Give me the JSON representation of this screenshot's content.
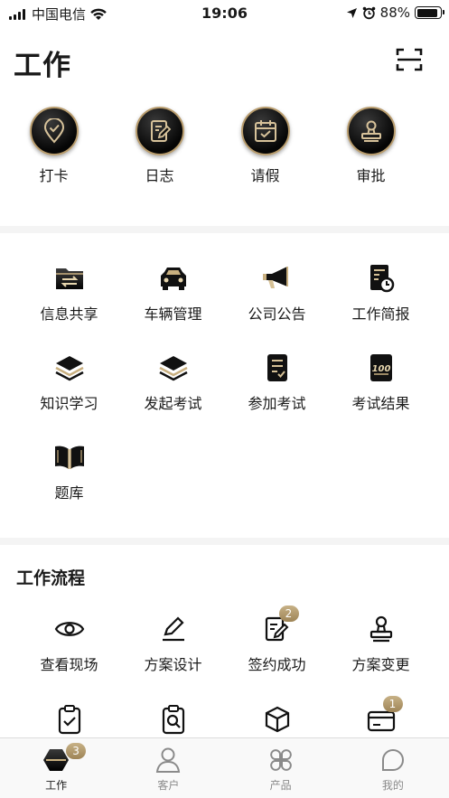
{
  "status_bar": {
    "carrier": "中国电信",
    "time": "19:06",
    "battery": "88%",
    "battery_level": 0.88
  },
  "header": {
    "title": "工作"
  },
  "quick_actions": [
    {
      "label": "打卡",
      "icon": "location-check-icon"
    },
    {
      "label": "日志",
      "icon": "journal-edit-icon"
    },
    {
      "label": "请假",
      "icon": "calendar-check-icon"
    },
    {
      "label": "审批",
      "icon": "stamp-icon"
    }
  ],
  "tools": [
    {
      "label": "信息共享",
      "icon": "folder-share-icon"
    },
    {
      "label": "车辆管理",
      "icon": "car-icon"
    },
    {
      "label": "公司公告",
      "icon": "megaphone-icon"
    },
    {
      "label": "工作简报",
      "icon": "report-clock-icon"
    },
    {
      "label": "知识学习",
      "icon": "layers-icon"
    },
    {
      "label": "发起考试",
      "icon": "layers-icon"
    },
    {
      "label": "参加考试",
      "icon": "exam-list-icon"
    },
    {
      "label": "考试结果",
      "icon": "score-100-icon"
    },
    {
      "label": "题库",
      "icon": "book-icon"
    }
  ],
  "workflow": {
    "title": "工作流程",
    "items": [
      {
        "label": "查看现场",
        "icon": "eye-icon",
        "badge": ""
      },
      {
        "label": "方案设计",
        "icon": "pen-icon",
        "badge": ""
      },
      {
        "label": "签约成功",
        "icon": "contract-edit-icon",
        "badge": "2"
      },
      {
        "label": "方案变更",
        "icon": "stamp-outline-icon",
        "badge": ""
      },
      {
        "label": "",
        "icon": "clipboard-check-icon",
        "badge": ""
      },
      {
        "label": "",
        "icon": "clipboard-search-icon",
        "badge": ""
      },
      {
        "label": "",
        "icon": "box-icon",
        "badge": ""
      },
      {
        "label": "",
        "icon": "card-icon",
        "badge": "1"
      }
    ]
  },
  "tabbar": [
    {
      "label": "工作",
      "icon": "work-hexagon-icon",
      "badge": "3",
      "active": true
    },
    {
      "label": "客户",
      "icon": "person-icon",
      "badge": "",
      "active": false
    },
    {
      "label": "产品",
      "icon": "product-grid-icon",
      "badge": "",
      "active": false
    },
    {
      "label": "我的",
      "icon": "leaf-profile-icon",
      "badge": "",
      "active": false
    }
  ],
  "colors": {
    "accent_gold": "#b79b6c",
    "icon_dark": "#111111",
    "badge": "#b29a6c"
  }
}
